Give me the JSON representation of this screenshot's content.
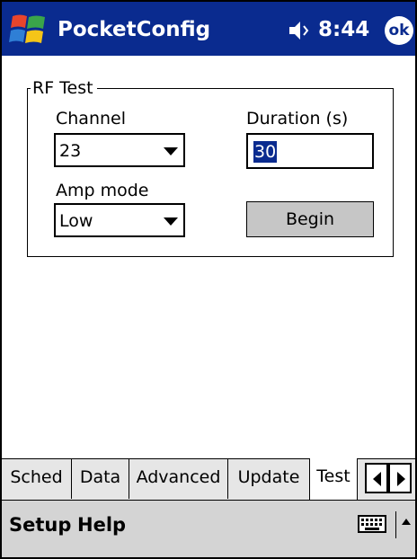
{
  "titlebar": {
    "app_title": "PocketConfig",
    "time": "8:44",
    "ok_label": "ok"
  },
  "group": {
    "title": "RF Test",
    "channel_label": "Channel",
    "channel_value": "23",
    "duration_label": "Duration (s)",
    "duration_value": "30",
    "amp_label": "Amp mode",
    "amp_value": "Low",
    "begin_label": "Begin"
  },
  "tabs": [
    {
      "label": "Sched",
      "active": false
    },
    {
      "label": "Data",
      "active": false
    },
    {
      "label": "Advanced",
      "active": false
    },
    {
      "label": "Update",
      "active": false
    },
    {
      "label": "Test",
      "active": true
    }
  ],
  "menubar": {
    "setup_label": "Setup",
    "help_label": "Help"
  },
  "icons": {
    "start": "windows-flag-icon",
    "volume": "speaker-icon",
    "ok": "ok-icon",
    "keyboard": "keyboard-icon",
    "scroll_left": "triangle-left-icon",
    "scroll_right": "triangle-right-icon",
    "sip": "triangle-up-icon"
  },
  "colors": {
    "titlebar": "#0a2b8f",
    "selection": "#0a2b8f",
    "tabbar": "#e6e6e6",
    "menubar": "#d4d4d4",
    "button": "#c6c6c6"
  }
}
